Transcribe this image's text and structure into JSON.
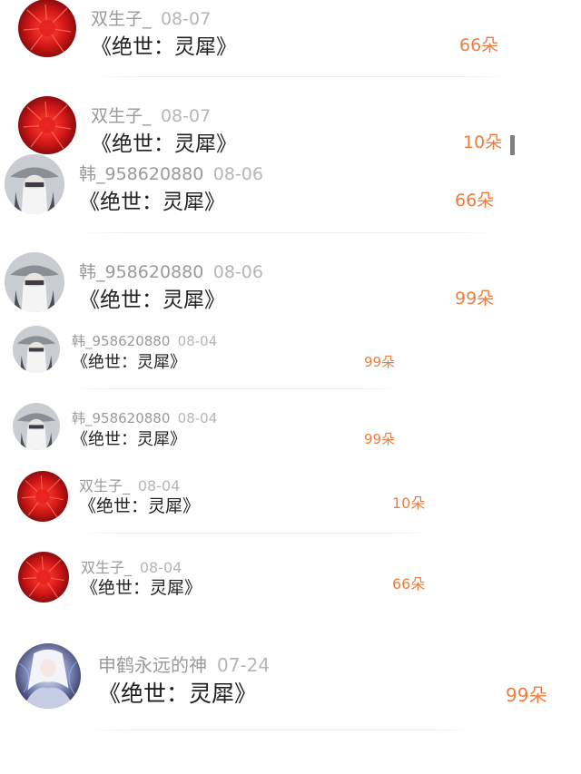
{
  "comments": [
    {
      "user": "双生子_",
      "date": "08-07",
      "title": "《绝世：灵犀》",
      "gift": "66朵",
      "avatar": "red-flower-avatar"
    },
    {
      "user": "双生子_",
      "date": "08-07",
      "title": "《绝世：灵犀》",
      "gift": "10朵",
      "avatar": "red-flower-avatar"
    },
    {
      "user": "韩_958620880",
      "date": "08-06",
      "title": "《绝世：灵犀》",
      "gift": "66朵",
      "avatar": "hat-figure-avatar"
    },
    {
      "user": "韩_958620880",
      "date": "08-06",
      "title": "《绝世：灵犀》",
      "gift": "99朵",
      "avatar": "hat-figure-avatar"
    },
    {
      "user": "韩_958620880",
      "date": "08-04",
      "title": "《绝世：灵犀》",
      "gift": "99朵",
      "avatar": "hat-figure-avatar"
    },
    {
      "user": "韩_958620880",
      "date": "08-04",
      "title": "《绝世：灵犀》",
      "gift": "99朵",
      "avatar": "hat-figure-avatar"
    },
    {
      "user": "双生子_",
      "date": "08-04",
      "title": "《绝世：灵犀》",
      "gift": "10朵",
      "avatar": "red-flower-avatar"
    },
    {
      "user": "双生子_",
      "date": "08-04",
      "title": "《绝世：灵犀》",
      "gift": "66朵",
      "avatar": "red-flower-avatar"
    },
    {
      "user": "申鹤永远的神",
      "date": "07-24",
      "title": "《绝世：灵犀》",
      "gift": "99朵",
      "avatar": "anime-character-avatar"
    }
  ],
  "colors": {
    "gift": "#f07c3e",
    "username": "#9a9a9a",
    "title": "#1f1f1f"
  }
}
